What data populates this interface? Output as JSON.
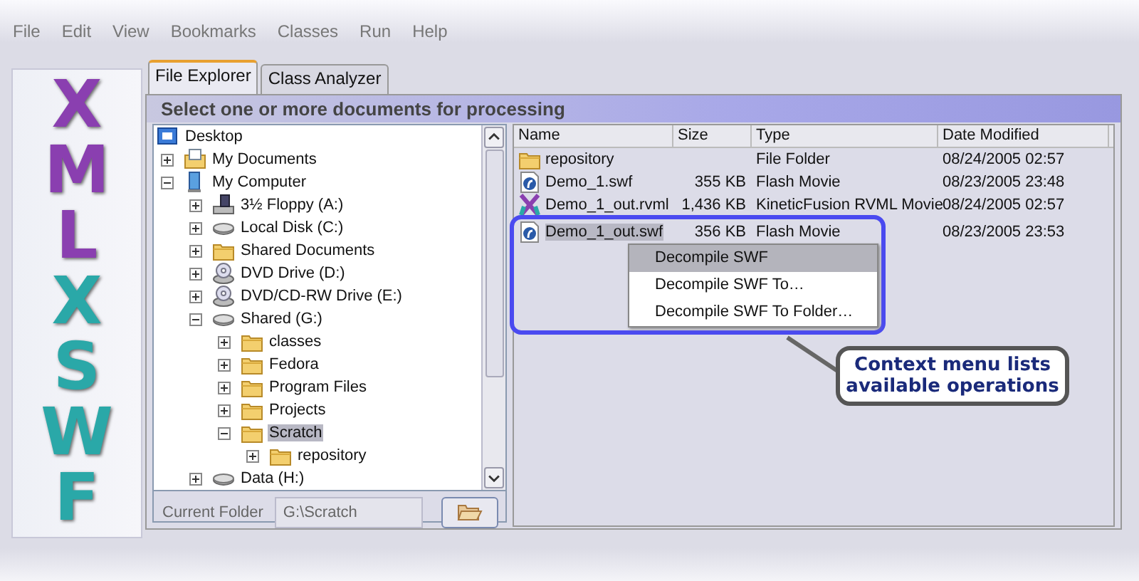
{
  "menu_bar": [
    "File",
    "Edit",
    "View",
    "Bookmarks",
    "Classes",
    "Run",
    "Help"
  ],
  "banner": {
    "letters": [
      {
        "char": "X",
        "color": "#8a3fb0"
      },
      {
        "char": "M",
        "color": "#8a3fb0"
      },
      {
        "char": "L",
        "color": "#8a3fb0"
      },
      {
        "char": "X",
        "color": "#2aa8a8"
      },
      {
        "char": "S",
        "color": "#2aa8a8"
      },
      {
        "char": "W",
        "color": "#2aa8a8"
      },
      {
        "char": "F",
        "color": "#2aa8a8"
      }
    ]
  },
  "tabs": [
    {
      "label": "File Explorer",
      "selected": true
    },
    {
      "label": "Class Analyzer",
      "selected": false
    }
  ],
  "header": "Select one or more documents for processing",
  "tree": {
    "nodes": [
      {
        "label": "Desktop",
        "kind": "desktop",
        "selected": false,
        "children": [
          {
            "label": "My Documents",
            "kind": "documents",
            "expanded": false,
            "selected": false
          },
          {
            "label": "My Computer",
            "kind": "computer",
            "expanded": true,
            "selected": false,
            "children": [
              {
                "label": "3½ Floppy (A:)",
                "kind": "floppy",
                "expanded": false,
                "selected": false
              },
              {
                "label": "Local Disk (C:)",
                "kind": "drive",
                "expanded": false,
                "selected": false
              },
              {
                "label": "Shared Documents",
                "kind": "folder",
                "expanded": false,
                "selected": false
              },
              {
                "label": "DVD Drive (D:)",
                "kind": "dvd",
                "expanded": false,
                "selected": false
              },
              {
                "label": "DVD/CD-RW Drive (E:)",
                "kind": "dvd",
                "expanded": false,
                "selected": false
              },
              {
                "label": "Shared (G:)",
                "kind": "drive",
                "expanded": true,
                "selected": false,
                "children": [
                  {
                    "label": "classes",
                    "kind": "folder",
                    "expanded": false,
                    "selected": false
                  },
                  {
                    "label": "Fedora",
                    "kind": "folder",
                    "expanded": false,
                    "selected": false
                  },
                  {
                    "label": "Program Files",
                    "kind": "folder",
                    "expanded": false,
                    "selected": false
                  },
                  {
                    "label": "Projects",
                    "kind": "folder",
                    "expanded": false,
                    "selected": false
                  },
                  {
                    "label": "Scratch",
                    "kind": "folder",
                    "expanded": true,
                    "selected": true,
                    "children": [
                      {
                        "label": "repository",
                        "kind": "folder",
                        "expanded": false,
                        "selected": false
                      }
                    ]
                  }
                ]
              },
              {
                "label": "Data (H:)",
                "kind": "drive",
                "expanded": false,
                "selected": false
              }
            ]
          }
        ]
      }
    ]
  },
  "current_folder": {
    "label": "Current Folder",
    "value": "G:\\Scratch"
  },
  "files": {
    "columns": [
      "Name",
      "Size",
      "Type",
      "Date Modified"
    ],
    "rows": [
      {
        "kind": "folder",
        "name": "repository",
        "type": "File Folder",
        "date": "08/24/2005 02:57",
        "selected": false
      },
      {
        "kind": "swf",
        "name": "Demo_1.swf",
        "size": "355 KB",
        "type": "Flash Movie",
        "date": "08/23/2005 23:48",
        "selected": false
      },
      {
        "kind": "rvml",
        "name": "Demo_1_out.rvml",
        "size": "1,436 KB",
        "type": "KineticFusion RVML Movie",
        "date": "08/24/2005 02:57",
        "selected": false
      },
      {
        "kind": "swf",
        "name": "Demo_1_out.swf",
        "size": "356 KB",
        "type": "Flash Movie",
        "date": "08/23/2005 23:53",
        "selected": true
      }
    ]
  },
  "context_menu": [
    {
      "label": "Decompile SWF",
      "selected": true
    },
    {
      "label": "Decompile SWF To…",
      "selected": false
    },
    {
      "label": "Decompile SWF To Folder…",
      "selected": false
    }
  ],
  "callout": {
    "lines": [
      "Context menu lists",
      "available operations"
    ]
  }
}
